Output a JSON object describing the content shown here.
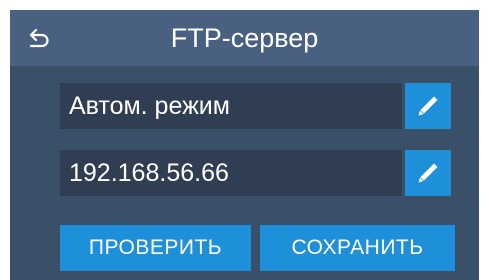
{
  "header": {
    "title": "FTP-сервер",
    "back_icon": "back-arrow-icon"
  },
  "fields": [
    {
      "value": "Автом. режим",
      "edit_icon": "pencil-icon"
    },
    {
      "value": "192.168.56.66",
      "edit_icon": "pencil-icon"
    }
  ],
  "actions": {
    "check_label": "ПРОВЕРИТЬ",
    "save_label": "СОХРАНИТЬ"
  },
  "colors": {
    "background": "#3a4f68",
    "header": "#4a6080",
    "field": "#2f3e52",
    "accent": "#1e8fd9",
    "text": "#ffffff"
  }
}
